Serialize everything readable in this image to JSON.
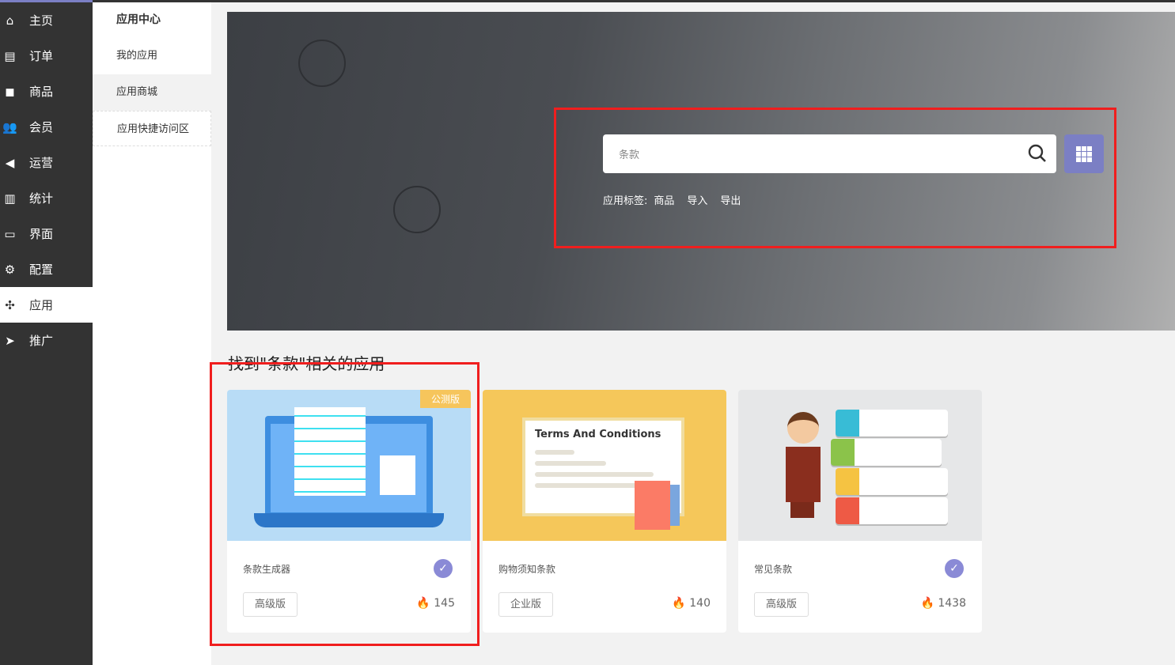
{
  "colors": {
    "sidebar": "#333333",
    "accent": "#7b7fc4",
    "highlight": "#f01e1e",
    "badge": "#f6c55c"
  },
  "sidebar": {
    "items": [
      {
        "label": "主页",
        "icon": "home-icon"
      },
      {
        "label": "订单",
        "icon": "order-icon"
      },
      {
        "label": "商品",
        "icon": "box-icon"
      },
      {
        "label": "会员",
        "icon": "users-icon"
      },
      {
        "label": "运营",
        "icon": "megaphone-icon"
      },
      {
        "label": "统计",
        "icon": "bar-chart-icon"
      },
      {
        "label": "界面",
        "icon": "store-icon"
      },
      {
        "label": "配置",
        "icon": "gear-icon"
      },
      {
        "label": "应用",
        "icon": "puzzle-icon",
        "active": true
      },
      {
        "label": "推广",
        "icon": "paper-plane-icon"
      }
    ]
  },
  "submenu": {
    "title": "应用中心",
    "items": [
      "我的应用",
      "应用商城",
      "应用快捷访问区"
    ],
    "selected": "应用商城"
  },
  "search": {
    "value": "条款",
    "tags_label": "应用标签:",
    "tags": [
      "商品",
      "导入",
      "导出"
    ]
  },
  "results": {
    "heading": "找到\"条款\"相关的应用",
    "cards": [
      {
        "name": "条款生成器",
        "badge": "公测版",
        "edition": "高级版",
        "count": "145",
        "verified": true
      },
      {
        "name": "购物须知条款",
        "edition": "企业版",
        "count": "140",
        "verified": false,
        "image_text": "Terms And Conditions"
      },
      {
        "name": "常见条款",
        "edition": "高级版",
        "count": "1438",
        "verified": true
      }
    ]
  }
}
